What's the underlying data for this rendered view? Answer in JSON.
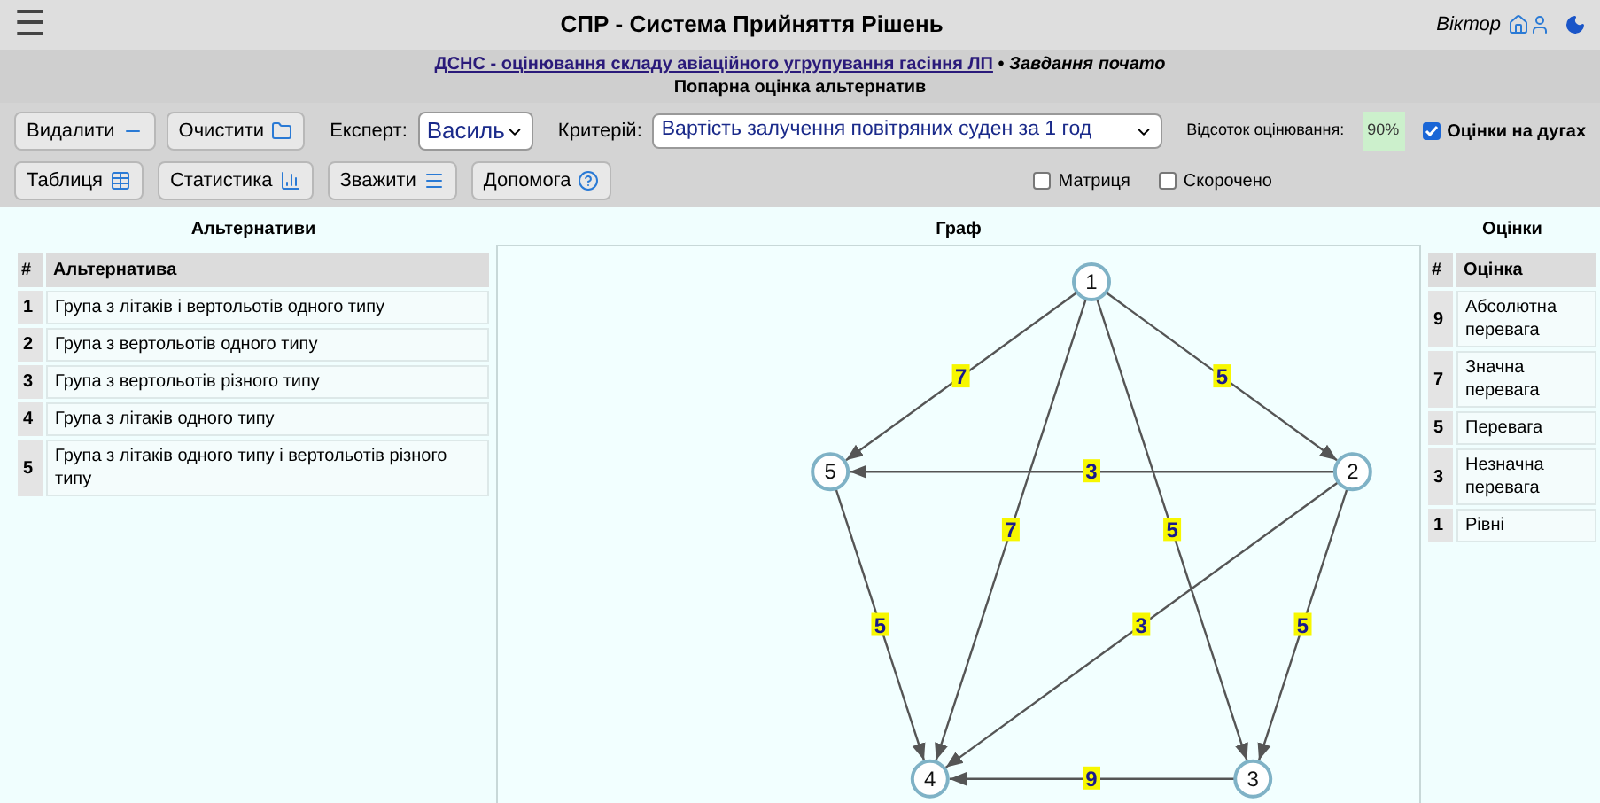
{
  "header": {
    "menu_glyph": "☰",
    "title": "СПР - Система Прийняття Рішень",
    "user": "Віктор"
  },
  "task": {
    "link": "ДСНС - оцінювання складу авіаційного угрупування гасіння ЛП",
    "separator": "•",
    "status": "Завдання почато",
    "subtitle": "Попарна оцінка альтернатив"
  },
  "toolbar": {
    "buttons_row1": [
      {
        "label": "Видалити"
      },
      {
        "label": "Очистити"
      }
    ],
    "expert": {
      "label": "Експерт:",
      "value": "Василь"
    },
    "criterion": {
      "label": "Критерій:",
      "value": "Вартість залучення повітряних суден за 1 год"
    },
    "progress": {
      "label": "Відсоток оцінювання:",
      "value": "90%"
    },
    "checkboxes": [
      {
        "label": "Оцінки на дугах",
        "checked": true
      },
      {
        "label": "Матриця",
        "checked": false
      },
      {
        "label": "Скорочено",
        "checked": false
      }
    ],
    "buttons_row2": [
      {
        "label": "Таблиця"
      },
      {
        "label": "Статистика"
      },
      {
        "label": "Зважити"
      },
      {
        "label": "Допомога"
      }
    ]
  },
  "alternatives": {
    "title": "Альтернативи",
    "columns": [
      "#",
      "Альтернатива"
    ],
    "rows": [
      {
        "n": "1",
        "name": "Група з літаків і вертольотів одного типу"
      },
      {
        "n": "2",
        "name": "Група з вертольотів одного типу"
      },
      {
        "n": "3",
        "name": "Група з вертольотів різного типу"
      },
      {
        "n": "4",
        "name": "Група з літаків одного типу"
      },
      {
        "n": "5",
        "name": "Група з літаків одного типу і вертольотів різного типу"
      }
    ]
  },
  "graph": {
    "title": "Граф",
    "nodes": [
      "1",
      "2",
      "3",
      "4",
      "5"
    ],
    "edges": [
      {
        "weight": "7"
      },
      {
        "weight": "5"
      },
      {
        "weight": "3"
      },
      {
        "weight": "7"
      },
      {
        "weight": "5"
      },
      {
        "weight": "5"
      },
      {
        "weight": "3"
      },
      {
        "weight": "5"
      },
      {
        "weight": "9"
      }
    ]
  },
  "scores": {
    "title": "Оцінки",
    "columns": [
      "#",
      "Оцінка"
    ],
    "rows": [
      {
        "n": "9",
        "name": "Абсолютна перевага"
      },
      {
        "n": "7",
        "name": "Значна перевага"
      },
      {
        "n": "5",
        "name": "Перевага"
      },
      {
        "n": "3",
        "name": "Незначна перевага"
      },
      {
        "n": "1",
        "name": "Рівні"
      }
    ]
  }
}
